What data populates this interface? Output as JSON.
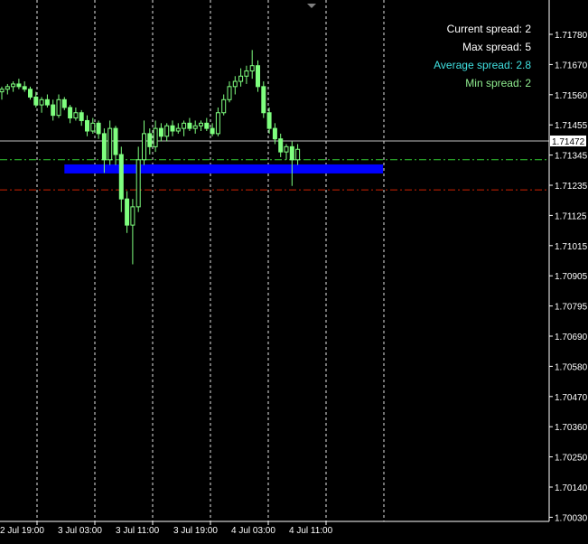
{
  "colors": {
    "background": "#000000",
    "axis": "#ffffff",
    "candle": "#7fff7f",
    "grid": "#ffffff",
    "bid_line": "#c0c0c0",
    "level_band": "#0000ff",
    "green_dash": "#33cc33",
    "red_dash": "#cc2200",
    "info_white": "#ffffff",
    "info_cyan": "#40e0e0",
    "info_lightgreen": "#90ee90"
  },
  "scroll_marker_icon": "triangle-down-icon",
  "spread_info": {
    "current": "Current spread: 2",
    "max": "Max spread: 5",
    "average": "Average spread: 2.8",
    "min": "Min spread: 2"
  },
  "chart_data": {
    "type": "candlestick",
    "price_axis": {
      "ylim": [
        1.7003,
        1.7188
      ],
      "tick_values": [
        1.7178,
        1.7167,
        1.7156,
        1.71455,
        1.71345,
        1.71235,
        1.71125,
        1.71015,
        1.70905,
        1.70795,
        1.7069,
        1.7058,
        1.7047,
        1.7036,
        1.7025,
        1.7014,
        1.7003
      ],
      "tick_labels": [
        "1.71780",
        "1.71670",
        "1.71560",
        "1.71455",
        "1.71345",
        "1.71235",
        "1.71125",
        "1.71015",
        "1.70905",
        "1.70795",
        "1.70690",
        "1.70580",
        "1.70470",
        "1.70360",
        "1.70250",
        "1.70140",
        "1.70030"
      ],
      "current_price": "1.71472"
    },
    "time_axis": {
      "tick_labels": [
        "2 Jul 19:00",
        "3 Jul 03:00",
        "3 Jul 11:00",
        "3 Jul 19:00",
        "4 Jul 03:00",
        "4 Jul 11:00"
      ],
      "xlim": [
        0,
        100
      ]
    },
    "horizontal_levels": {
      "bid": 1.71472,
      "green_dashdot": 1.714,
      "red_dashdot": 1.71285,
      "blue_band_center": 1.71365,
      "blue_band_start": 11,
      "blue_band_end": 67
    },
    "candles": [
      [
        0,
        1.7166,
        1.7168,
        1.7163,
        1.7167
      ],
      [
        1,
        1.7167,
        1.7169,
        1.7165,
        1.7168
      ],
      [
        2,
        1.7168,
        1.717,
        1.7166,
        1.7169
      ],
      [
        3,
        1.7169,
        1.7171,
        1.7167,
        1.7168
      ],
      [
        4,
        1.7168,
        1.717,
        1.7166,
        1.7167
      ],
      [
        5,
        1.7167,
        1.7168,
        1.7163,
        1.7164
      ],
      [
        6,
        1.7164,
        1.7166,
        1.716,
        1.7161
      ],
      [
        7,
        1.7161,
        1.7164,
        1.7158,
        1.7163
      ],
      [
        8,
        1.7163,
        1.7165,
        1.716,
        1.7161
      ],
      [
        9,
        1.7161,
        1.7163,
        1.7155,
        1.7157
      ],
      [
        10,
        1.7157,
        1.7165,
        1.7156,
        1.7163
      ],
      [
        11,
        1.7163,
        1.7164,
        1.7159,
        1.716
      ],
      [
        12,
        1.716,
        1.7161,
        1.7154,
        1.7156
      ],
      [
        13,
        1.7156,
        1.716,
        1.7155,
        1.7158
      ],
      [
        14,
        1.7158,
        1.7159,
        1.7153,
        1.7155
      ],
      [
        15,
        1.7155,
        1.7157,
        1.7149,
        1.7151
      ],
      [
        16,
        1.7151,
        1.7156,
        1.715,
        1.7154
      ],
      [
        17,
        1.7154,
        1.7155,
        1.7148,
        1.715
      ],
      [
        18,
        1.715,
        1.7152,
        1.7135,
        1.714
      ],
      [
        19,
        1.714,
        1.7155,
        1.7138,
        1.7152
      ],
      [
        20,
        1.7152,
        1.7153,
        1.7138,
        1.7142
      ],
      [
        21,
        1.7142,
        1.7145,
        1.712,
        1.7125
      ],
      [
        22,
        1.7125,
        1.7128,
        1.7112,
        1.7115
      ],
      [
        23,
        1.7115,
        1.7125,
        1.71,
        1.7122
      ],
      [
        24,
        1.7122,
        1.7145,
        1.712,
        1.714
      ],
      [
        25,
        1.714,
        1.7155,
        1.7138,
        1.715
      ],
      [
        26,
        1.715,
        1.7152,
        1.7142,
        1.7145
      ],
      [
        27,
        1.7145,
        1.7155,
        1.7143,
        1.7152
      ],
      [
        28,
        1.7152,
        1.7154,
        1.7147,
        1.7149
      ],
      [
        29,
        1.7149,
        1.7154,
        1.7147,
        1.7153
      ],
      [
        30,
        1.7153,
        1.7155,
        1.7149,
        1.7151
      ],
      [
        31,
        1.7151,
        1.7154,
        1.715,
        1.7152
      ],
      [
        32,
        1.7152,
        1.7155,
        1.7149,
        1.7154
      ],
      [
        33,
        1.7154,
        1.7156,
        1.7151,
        1.7152
      ],
      [
        34,
        1.7152,
        1.7155,
        1.715,
        1.7153
      ],
      [
        35,
        1.7153,
        1.7155,
        1.7151,
        1.7154
      ],
      [
        36,
        1.7154,
        1.7156,
        1.7151,
        1.7152
      ],
      [
        37,
        1.7152,
        1.7154,
        1.7149,
        1.715
      ],
      [
        38,
        1.715,
        1.716,
        1.7149,
        1.7158
      ],
      [
        39,
        1.7158,
        1.7165,
        1.7157,
        1.7163
      ],
      [
        40,
        1.7163,
        1.717,
        1.7162,
        1.7168
      ],
      [
        41,
        1.7168,
        1.7172,
        1.7165,
        1.717
      ],
      [
        42,
        1.717,
        1.7175,
        1.7168,
        1.7172
      ],
      [
        43,
        1.7172,
        1.7176,
        1.7169,
        1.7174
      ],
      [
        44,
        1.7174,
        1.7182,
        1.7171,
        1.7176
      ],
      [
        45,
        1.7176,
        1.7178,
        1.7166,
        1.7168
      ],
      [
        46,
        1.7168,
        1.717,
        1.7156,
        1.7158
      ],
      [
        47,
        1.7158,
        1.716,
        1.715,
        1.7152
      ],
      [
        48,
        1.7152,
        1.7154,
        1.7146,
        1.7148
      ],
      [
        49,
        1.7148,
        1.715,
        1.7141,
        1.7143
      ],
      [
        50,
        1.7143,
        1.7146,
        1.714,
        1.7145
      ],
      [
        51,
        1.7145,
        1.7147,
        1.713,
        1.714
      ],
      [
        52,
        1.714,
        1.7146,
        1.7138,
        1.7144
      ]
    ]
  }
}
